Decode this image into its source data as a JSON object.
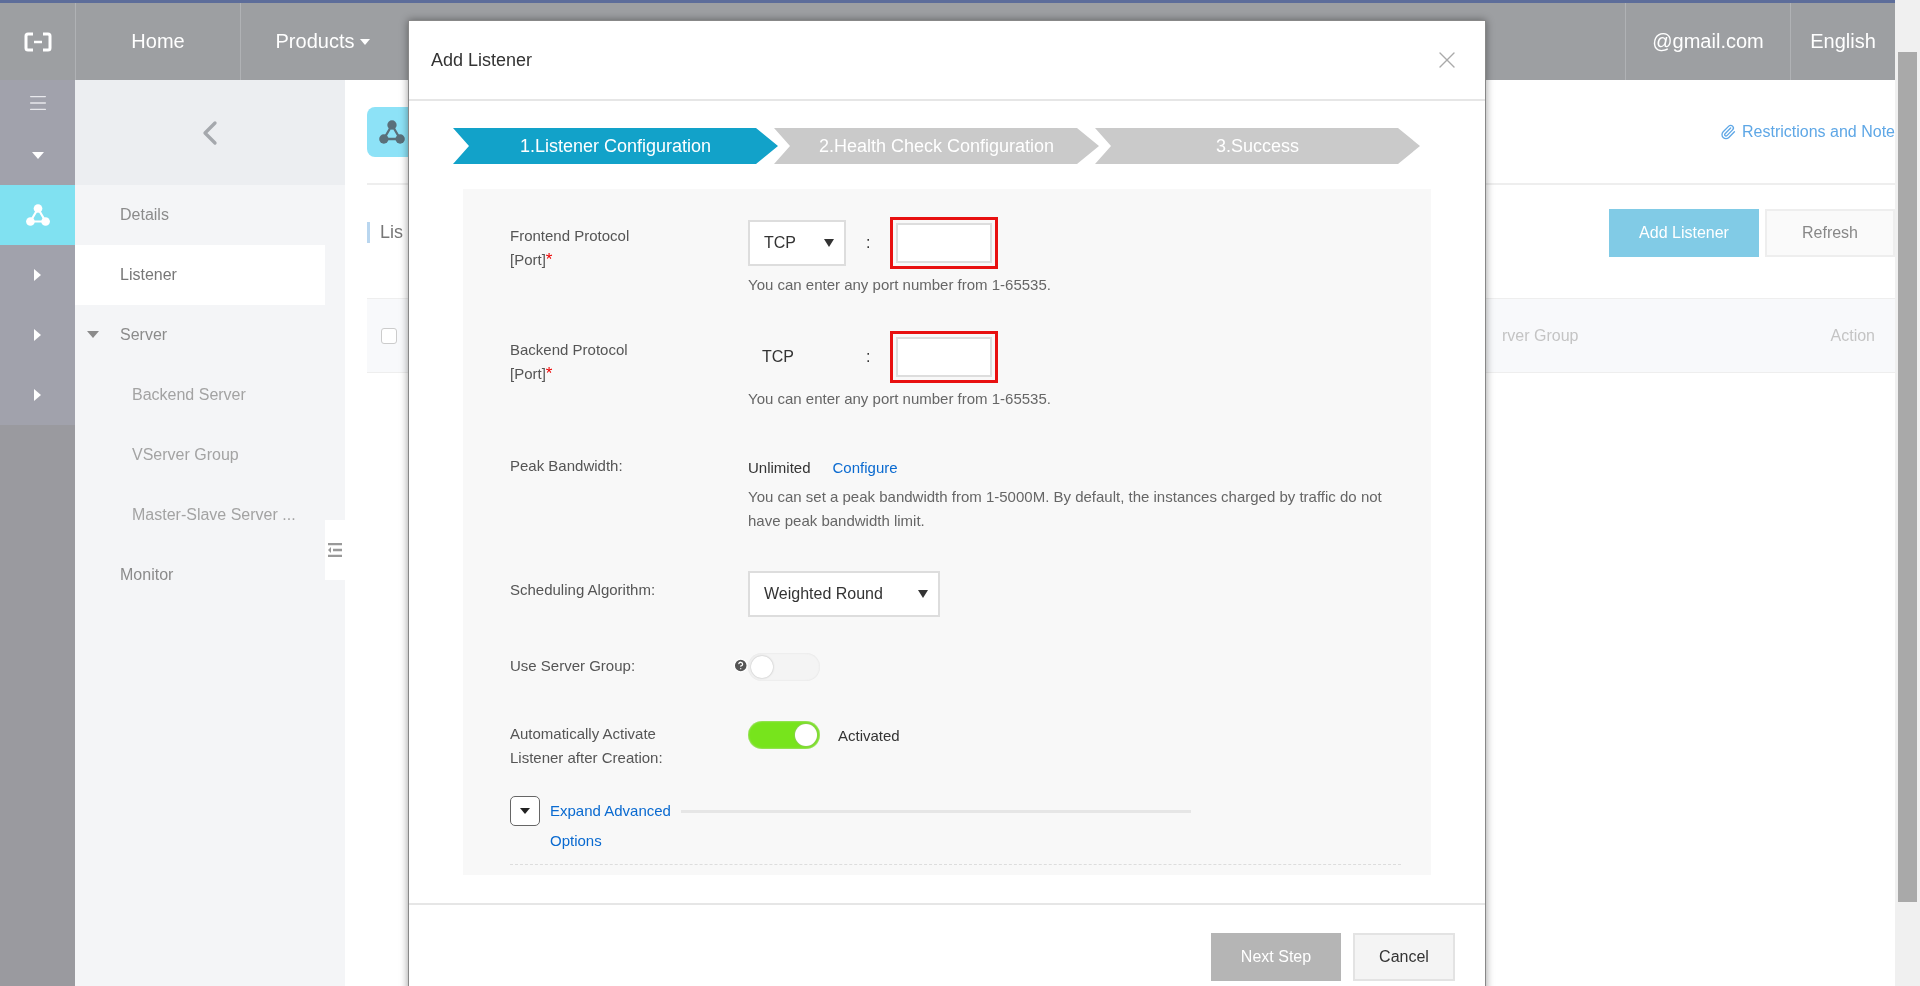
{
  "topbar": {
    "nav": [
      {
        "label": "Home",
        "dropdown": false
      },
      {
        "label": "Products",
        "dropdown": true
      }
    ],
    "account": "@gmail.com",
    "language": "English"
  },
  "rail": [
    {
      "kind": "menu",
      "selected": false
    },
    {
      "kind": "caret-down",
      "selected": false
    },
    {
      "kind": "product",
      "selected": true
    },
    {
      "kind": "caret-right",
      "selected": false
    },
    {
      "kind": "caret-right",
      "selected": false
    },
    {
      "kind": "caret-right",
      "selected": false
    }
  ],
  "nav": {
    "items": [
      {
        "label": "Details",
        "selected": false
      },
      {
        "label": "Listener",
        "selected": true
      },
      {
        "label": "Server",
        "selected": false,
        "expanded": true,
        "children": [
          {
            "label": "Backend Server",
            "selected": false
          },
          {
            "label": "VServer Group",
            "selected": false
          },
          {
            "label": "Master-Slave Server ...",
            "selected": false
          }
        ]
      },
      {
        "label": "Monitor",
        "selected": false
      }
    ]
  },
  "page": {
    "heading": "Lis",
    "notes_link": "Restrictions and Note",
    "buttons": [
      {
        "label": "Add Listener",
        "kind": "primary"
      },
      {
        "label": "Refresh",
        "kind": "default"
      }
    ],
    "table": {
      "select_all": {
        "checked": false
      },
      "columns": [
        {
          "label": "rver Group"
        },
        {
          "label": "Action"
        }
      ]
    }
  },
  "modal": {
    "title": "Add Listener",
    "steps": [
      {
        "label": "1.Listener Configuration",
        "selected": true
      },
      {
        "label": "2.Health Check Configuration",
        "selected": false
      },
      {
        "label": "3.Success",
        "selected": false
      }
    ],
    "fields": [
      {
        "kind": "protocol-port",
        "label_lines": [
          "Frontend Protocol",
          "[Port]"
        ],
        "required_mark": "*",
        "protocol": "TCP",
        "protocol_dropdown": true,
        "separator": ":",
        "highlighted": true,
        "hint": "You can enter any port number from 1-65535."
      },
      {
        "kind": "protocol-port",
        "label_lines": [
          "Backend Protocol",
          "[Port]"
        ],
        "required_mark": "*",
        "protocol": "TCP",
        "protocol_dropdown": false,
        "separator": ":",
        "highlighted": true,
        "hint": "You can enter any port number from 1-65535."
      },
      {
        "kind": "bandwidth",
        "label_lines": [
          "Peak Bandwidth:"
        ],
        "value": "Unlimited",
        "link": "Configure",
        "hint": "You can set a peak bandwidth from 1-5000M. By default, the instances charged by traffic do not have peak bandwidth limit."
      },
      {
        "kind": "select",
        "label_lines": [
          "Scheduling Algorithm:"
        ],
        "value": "Weighted Round"
      },
      {
        "kind": "toggle",
        "label_lines": [
          "Use Server Group:"
        ],
        "help": true,
        "on": false
      },
      {
        "kind": "toggle",
        "label_lines": [
          "Automatically Activate",
          "Listener after Creation:"
        ],
        "on": true,
        "status": "Activated"
      }
    ],
    "advanced": {
      "lines": [
        "Expand Advanced",
        "Options"
      ],
      "expanded": false
    },
    "footer": [
      {
        "label": "Next Step",
        "kind": "primary",
        "disabled": true
      },
      {
        "label": "Cancel",
        "kind": "default",
        "disabled": false
      }
    ]
  }
}
